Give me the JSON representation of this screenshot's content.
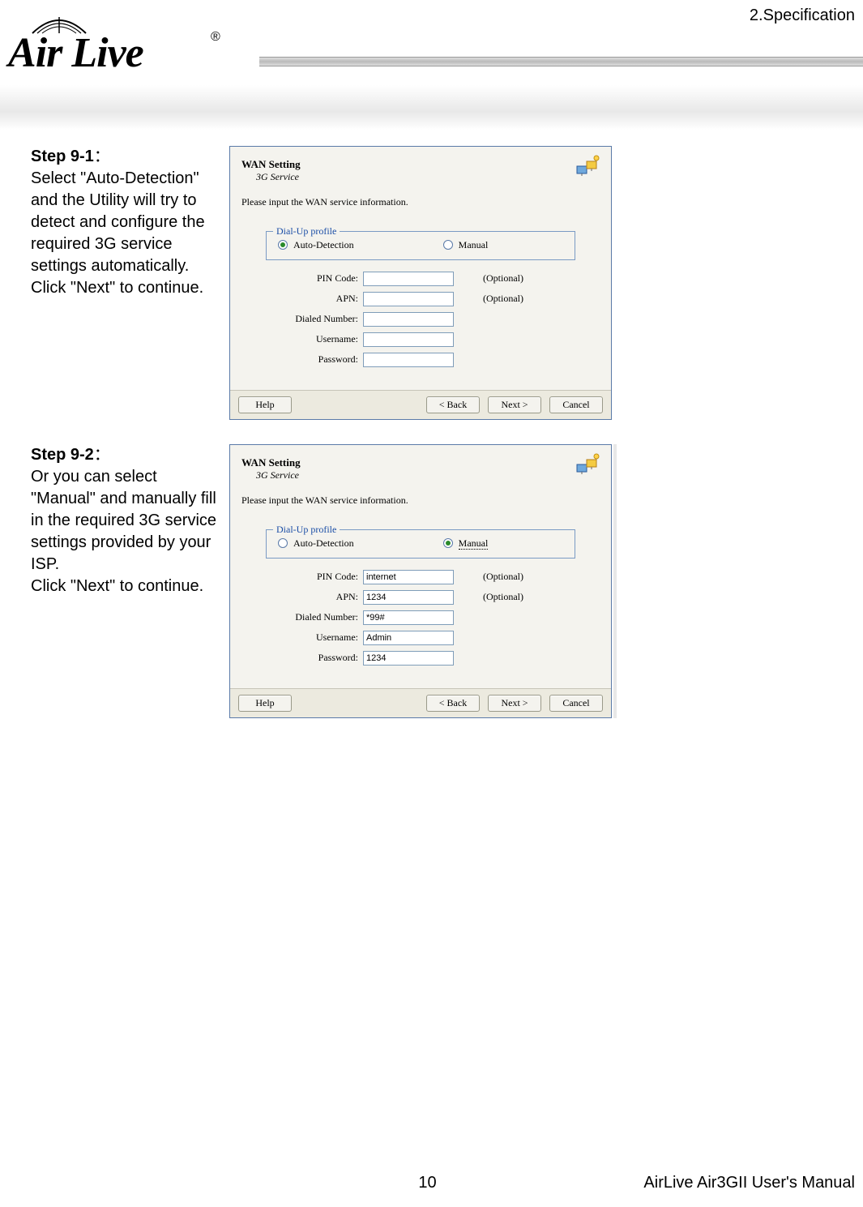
{
  "header": {
    "section": "2.Specification",
    "logo_text": "Air Live",
    "logo_reg": "®"
  },
  "step1": {
    "title": "Step 9-1",
    "colon": "：",
    "body": "Select \"Auto-Detection\" and the Utility will try to detect and configure the required 3G service settings automatically. Click \"Next\" to continue."
  },
  "step2": {
    "title": "Step 9-2",
    "colon": "：",
    "body": "Or you can select \"Manual\" and manually fill in the required 3G service settings provided by your ISP.\nClick \"Next\" to continue."
  },
  "dialog": {
    "title": "WAN Setting",
    "subtitle": "3G Service",
    "instruction": "Please input the WAN service information.",
    "fieldset_legend": "Dial-Up profile",
    "radio_auto": "Auto-Detection",
    "radio_manual": "Manual",
    "labels": {
      "pin": "PIN Code:",
      "apn": "APN:",
      "dialed": "Dialed Number:",
      "user": "Username:",
      "pass": "Password:"
    },
    "optional": "(Optional)",
    "buttons": {
      "help": "Help",
      "back": "< Back",
      "next": "Next >",
      "cancel": "Cancel"
    }
  },
  "dialog1_values": {
    "pin": "",
    "apn": "",
    "dialed": "",
    "user": "",
    "pass": ""
  },
  "dialog2_values": {
    "pin": "internet",
    "apn": "1234",
    "dialed": "*99#",
    "user": "Admin",
    "pass": "1234"
  },
  "footer": {
    "page": "10",
    "manual": "AirLive Air3GII User's Manual"
  }
}
